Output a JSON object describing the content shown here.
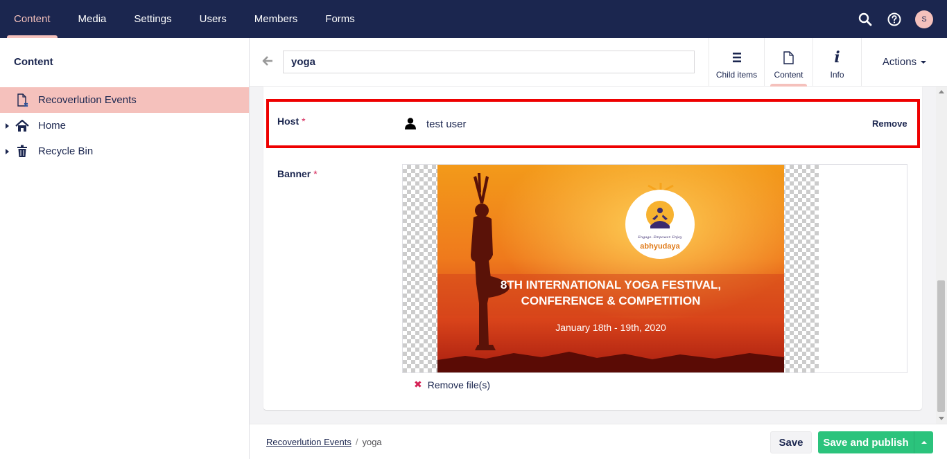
{
  "topnav": {
    "items": [
      "Content",
      "Media",
      "Settings",
      "Users",
      "Members",
      "Forms"
    ],
    "active": "Content",
    "icons": [
      "search-icon",
      "help-icon"
    ],
    "avatar_initial": "S"
  },
  "sidebar": {
    "title": "Content",
    "items": [
      {
        "label": "Recoverlution Events",
        "icon": "document-icon",
        "selected": true
      },
      {
        "label": "Home",
        "icon": "home-icon"
      },
      {
        "label": "Recycle Bin",
        "icon": "trash-icon"
      }
    ]
  },
  "editor": {
    "name_value": "yoga",
    "tabs": [
      {
        "label": "Child items",
        "icon": "list-icon"
      },
      {
        "label": "Content",
        "icon": "document-icon",
        "active": true
      },
      {
        "label": "Info",
        "icon": "info-icon"
      }
    ],
    "actions_label": "Actions"
  },
  "properties": {
    "host": {
      "label": "Host",
      "required_mark": "*",
      "value": "test user",
      "remove_label": "Remove"
    },
    "banner": {
      "label": "Banner",
      "required_mark": "*",
      "image_text_line1": "8TH INTERNATIONAL YOGA FESTIVAL,",
      "image_text_line2": "CONFERENCE & COMPETITION",
      "image_date": "January 18th - 19th, 2020",
      "logo_tagline": "Engage. Empower. Enjoy",
      "logo_name": "abhyudaya",
      "remove_files_label": "Remove file(s)"
    }
  },
  "footer": {
    "breadcrumb_parent": "Recoverlution Events",
    "breadcrumb_separator": "/",
    "breadcrumb_current": "yoga",
    "save_label": "Save",
    "publish_label": "Save and publish"
  },
  "colors": {
    "nav_bg": "#1b264f",
    "accent_pink": "#f5c1bc",
    "highlight_red": "#ee0000",
    "publish_green": "#2bc37c",
    "required_red": "#d42054"
  }
}
